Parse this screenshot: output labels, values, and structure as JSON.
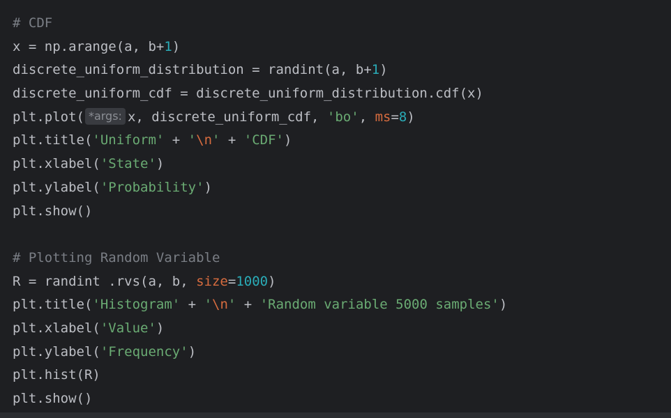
{
  "lines": [
    [
      {
        "t": "comment",
        "v": "# CDF"
      }
    ],
    [
      {
        "t": "ident",
        "v": "x = np.arange(a, b+"
      },
      {
        "t": "num",
        "v": "1"
      },
      {
        "t": "ident",
        "v": ")"
      }
    ],
    [
      {
        "t": "ident",
        "v": "discrete_uniform_distribution = randint(a, b+"
      },
      {
        "t": "num",
        "v": "1"
      },
      {
        "t": "ident",
        "v": ")"
      }
    ],
    [
      {
        "t": "ident",
        "v": "discrete_uniform_cdf = discrete_uniform_distribution.cdf(x)"
      }
    ],
    [
      {
        "t": "ident",
        "v": "plt.plot("
      },
      {
        "t": "hint",
        "v": "*args:"
      },
      {
        "t": "ident",
        "v": "x, discrete_uniform_cdf, "
      },
      {
        "t": "str",
        "v": "'bo'"
      },
      {
        "t": "ident",
        "v": ", "
      },
      {
        "t": "kw",
        "v": "ms"
      },
      {
        "t": "ident",
        "v": "="
      },
      {
        "t": "num",
        "v": "8"
      },
      {
        "t": "ident",
        "v": ")"
      }
    ],
    [
      {
        "t": "ident",
        "v": "plt.title("
      },
      {
        "t": "str",
        "v": "'Uniform'"
      },
      {
        "t": "ident",
        "v": " + "
      },
      {
        "t": "str",
        "v": "'"
      },
      {
        "t": "kw",
        "v": "\\n"
      },
      {
        "t": "str",
        "v": "'"
      },
      {
        "t": "ident",
        "v": " + "
      },
      {
        "t": "str",
        "v": "'CDF'"
      },
      {
        "t": "ident",
        "v": ")"
      }
    ],
    [
      {
        "t": "ident",
        "v": "plt.xlabel("
      },
      {
        "t": "str",
        "v": "'State'"
      },
      {
        "t": "ident",
        "v": ")"
      }
    ],
    [
      {
        "t": "ident",
        "v": "plt.ylabel("
      },
      {
        "t": "str",
        "v": "'Probability'"
      },
      {
        "t": "ident",
        "v": ")"
      }
    ],
    [
      {
        "t": "ident",
        "v": "plt.show()"
      }
    ],
    [],
    [
      {
        "t": "comment",
        "v": "# Plotting Random Variable"
      }
    ],
    [
      {
        "t": "ident",
        "v": "R = randint .rvs(a, b, "
      },
      {
        "t": "kw",
        "v": "size"
      },
      {
        "t": "ident",
        "v": "="
      },
      {
        "t": "num",
        "v": "1000"
      },
      {
        "t": "ident",
        "v": ")"
      }
    ],
    [
      {
        "t": "ident",
        "v": "plt.title("
      },
      {
        "t": "str",
        "v": "'Histogram'"
      },
      {
        "t": "ident",
        "v": " + "
      },
      {
        "t": "str",
        "v": "'"
      },
      {
        "t": "kw",
        "v": "\\n"
      },
      {
        "t": "str",
        "v": "'"
      },
      {
        "t": "ident",
        "v": " + "
      },
      {
        "t": "str",
        "v": "'Random variable 5000 samples'"
      },
      {
        "t": "ident",
        "v": ")"
      }
    ],
    [
      {
        "t": "ident",
        "v": "plt.xlabel("
      },
      {
        "t": "str",
        "v": "'Value'"
      },
      {
        "t": "ident",
        "v": ")"
      }
    ],
    [
      {
        "t": "ident",
        "v": "plt.ylabel("
      },
      {
        "t": "str",
        "v": "'Frequency'"
      },
      {
        "t": "ident",
        "v": ")"
      }
    ],
    [
      {
        "t": "ident",
        "v": "plt.hist(R)"
      }
    ],
    [
      {
        "t": "ident",
        "v": "plt.show()"
      }
    ]
  ],
  "colors": {
    "background": "#1e1f22",
    "text": "#bcbec4",
    "comment": "#7a7e85",
    "number": "#2aacb8",
    "string": "#6aab73",
    "keyword_arg": "#d76c3f",
    "hint_background": "#393b40"
  }
}
